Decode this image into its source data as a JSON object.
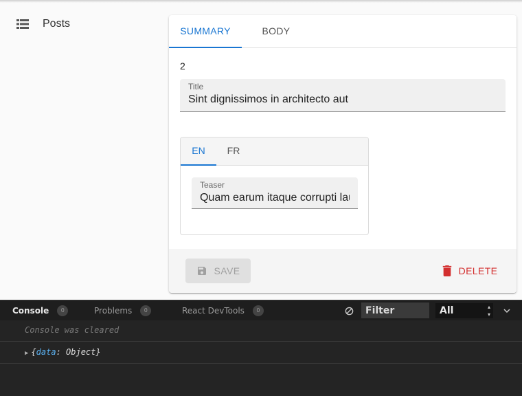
{
  "sidebar": {
    "items": [
      {
        "label": "Posts",
        "icon": "list-icon"
      }
    ]
  },
  "card": {
    "tabs": [
      {
        "label": "SUMMARY",
        "active": true
      },
      {
        "label": "BODY",
        "active": false
      }
    ],
    "record_id": "2",
    "title_field": {
      "label": "Title",
      "value": "Sint dignissimos in architecto aut"
    },
    "lang_tabs": [
      {
        "label": "EN",
        "active": true
      },
      {
        "label": "FR",
        "active": false
      }
    ],
    "teaser_field": {
      "label": "Teaser",
      "value": "Quam earum itaque corrupti laudantium"
    },
    "save_label": "SAVE",
    "delete_label": "DELETE"
  },
  "devtools": {
    "tabs": [
      {
        "label": "Console",
        "count": "0",
        "active": true
      },
      {
        "label": "Problems",
        "count": "0",
        "active": false
      },
      {
        "label": "React DevTools",
        "count": "0",
        "active": false
      }
    ],
    "filter_placeholder": "Filter",
    "level": "All",
    "cleared_text": "Console was cleared",
    "log": {
      "open": "{",
      "key": "data",
      "sep": ": ",
      "value": "Object",
      "close": "}"
    }
  },
  "colors": {
    "primary": "#1976d2",
    "danger": "#d32f2f"
  }
}
